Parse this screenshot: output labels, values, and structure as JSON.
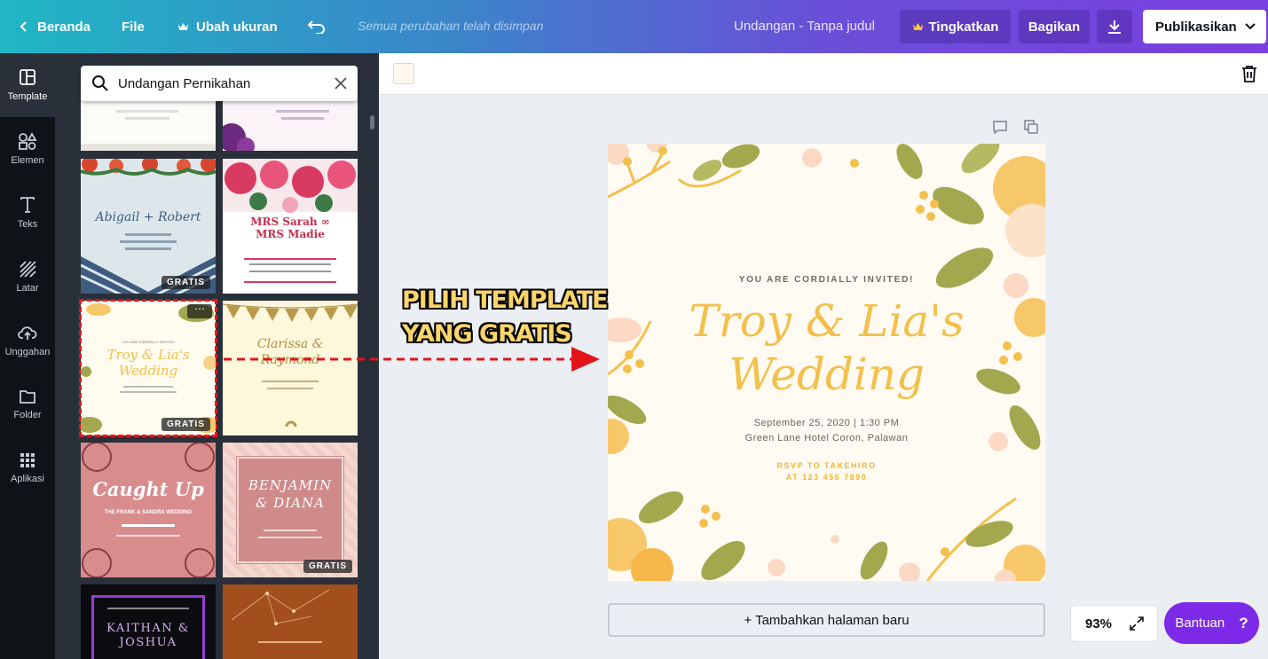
{
  "topbar": {
    "home_label": "Beranda",
    "file_label": "File",
    "resize_label": "Ubah ukuran",
    "saved_status": "Semua perubahan telah disimpan",
    "doc_title": "Undangan - Tanpa judul",
    "upgrade_label": "Tingkatkan",
    "share_label": "Bagikan",
    "publish_label": "Publikasikan"
  },
  "rail": {
    "items": [
      {
        "label": "Template",
        "icon": "template-icon"
      },
      {
        "label": "Elemen",
        "icon": "elements-icon"
      },
      {
        "label": "Teks",
        "icon": "text-icon"
      },
      {
        "label": "Latar",
        "icon": "background-icon"
      },
      {
        "label": "Unggahan",
        "icon": "upload-icon"
      },
      {
        "label": "Folder",
        "icon": "folder-icon"
      },
      {
        "label": "Aplikasi",
        "icon": "apps-icon"
      }
    ]
  },
  "panel": {
    "search_value": "Undangan Pernikahan",
    "free_badge": "GRATIS",
    "templates": [
      {
        "title": "Abigail + Robert",
        "free": true
      },
      {
        "title": "MRS Sarah ∞ MRS Madie",
        "free": false
      },
      {
        "title": "Troy & Lia's Wedding",
        "free": true,
        "selected": true
      },
      {
        "title": "Clarissa & Raymond",
        "free": false
      },
      {
        "title": "Caught Up",
        "subtitle": "THE FRANK & SANDRA WEDDING",
        "free": false
      },
      {
        "title": "BENJAMIN & DIANA",
        "free": true
      },
      {
        "title": "KAITHAN & JOSHUA",
        "free": false
      },
      {
        "title": "",
        "free": false
      }
    ]
  },
  "annotation": {
    "line1": "PILIH TEMPLATE",
    "line2": "YANG GRATIS"
  },
  "invitation": {
    "cordially": "YOU ARE CORDIALLY INVITED!",
    "title_line1": "Troy & Lia's",
    "title_line2": "Wedding",
    "date": "September 25, 2020 | 1:30 PM",
    "venue": "Green Lane Hotel Coron, Palawan",
    "rsvp1": "RSVP TO TAKEHIRO",
    "rsvp2": "AT 123 456 7890"
  },
  "canvas": {
    "add_page_label": "+ Tambahkan halaman baru",
    "zoom": "93%",
    "help_label": "Bantuan",
    "help_icon": "?"
  },
  "colors": {
    "accent_purple": "#7d2ae8",
    "selection_red": "#e4141b",
    "invite_yellow": "#f3c04b",
    "leaf_olive": "#a3a84e"
  }
}
